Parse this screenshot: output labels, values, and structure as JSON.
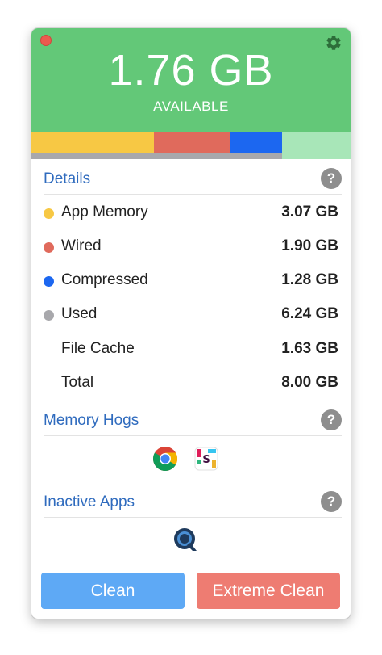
{
  "header": {
    "available_value": "1.76 GB",
    "available_label": "AVAILABLE",
    "background_color": "#63c878"
  },
  "usage_bar": {
    "segments": [
      {
        "name": "App Memory",
        "value_gb": 3.07,
        "color": "#f7c844"
      },
      {
        "name": "Wired",
        "value_gb": 1.9,
        "color": "#e06a5c"
      },
      {
        "name": "Compressed",
        "value_gb": 1.28,
        "color": "#1c67f0"
      },
      {
        "name": "Available",
        "value_gb": 1.76,
        "color": "#a8e6b8"
      }
    ],
    "used_color": "#a8a8ac"
  },
  "details": {
    "title": "Details",
    "help": "?",
    "rows": [
      {
        "label": "App Memory",
        "value": "3.07 GB",
        "dot_color": "#f7c844"
      },
      {
        "label": "Wired",
        "value": "1.90 GB",
        "dot_color": "#e06a5c"
      },
      {
        "label": "Compressed",
        "value": "1.28 GB",
        "dot_color": "#1c67f0"
      },
      {
        "label": "Used",
        "value": "6.24 GB",
        "dot_color": "#a8a8ac"
      },
      {
        "label": "File Cache",
        "value": "1.63 GB"
      },
      {
        "label": "Total",
        "value": "8.00 GB"
      }
    ]
  },
  "memory_hogs": {
    "title": "Memory Hogs",
    "help": "?",
    "apps": [
      "chrome-icon",
      "slack-icon"
    ]
  },
  "inactive_apps": {
    "title": "Inactive Apps",
    "help": "?",
    "apps": [
      "quicktime-icon"
    ]
  },
  "buttons": {
    "clean_label": "Clean",
    "clean_color": "#5ea9f5",
    "extreme_label": "Extreme Clean",
    "extreme_color": "#ee7c72"
  },
  "icons": {
    "close": "close-icon",
    "settings": "gear-icon"
  }
}
